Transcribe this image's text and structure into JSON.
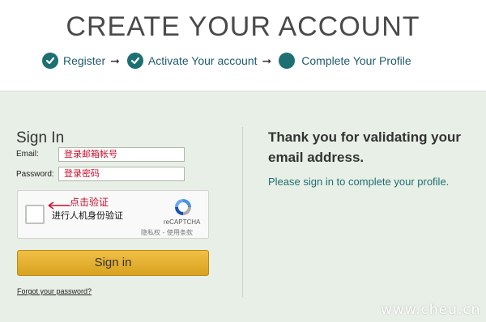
{
  "header": {
    "title": "CREATE YOUR ACCOUNT",
    "steps": [
      {
        "label": "Register",
        "icon": "check-circle-icon"
      },
      {
        "label": "Activate Your account",
        "icon": "check-circle-icon"
      },
      {
        "label": "Complete Your Profile",
        "icon": "filled-circle-icon"
      }
    ],
    "arrow": "➞"
  },
  "signin": {
    "title": "Sign In",
    "email_label": "Email:",
    "email_value": "登录邮箱帐号",
    "password_label": "Password:",
    "password_value": "登录密码",
    "captcha": {
      "hint": "点击验证",
      "text": "进行人机身份验证",
      "brand": "reCAPTCHA",
      "links": "隐私权 - 使用条款"
    },
    "button_label": "Sign in",
    "forgot_label": "Forgot your password?"
  },
  "info": {
    "thanks": "Thank you for validating your email address.",
    "please": "Please sign in to complete your profile."
  },
  "watermark": "www.cheu.cn",
  "colors": {
    "accent": "#1d6f72",
    "button": "#e6b23a",
    "panel": "#e8efe6",
    "hint_red": "#c8102e"
  }
}
